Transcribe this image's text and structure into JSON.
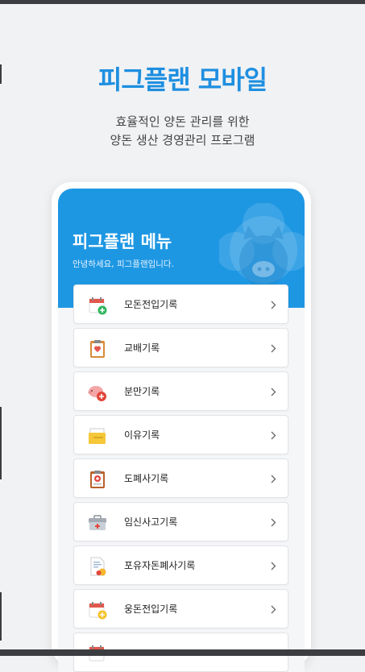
{
  "page": {
    "title": "피그플랜 모바일",
    "subtitle_line1": "효율적인 양돈 관리를 위한",
    "subtitle_line2": "양돈 생산 경영관리 프로그램"
  },
  "colors": {
    "accent": "#1e8fe0",
    "header_bg": "#1e97e3",
    "page_bg": "#f1f2f4"
  },
  "app": {
    "menu_title": "피그플랜 메뉴",
    "greeting": "안녕하세요, 피그플랜입니다.",
    "header_icon": "pig-icon"
  },
  "menu": {
    "items": [
      {
        "label": "모돈전입기록",
        "icon": "calendar-plus-icon"
      },
      {
        "label": "교배기록",
        "icon": "clipboard-heart-icon"
      },
      {
        "label": "분만기록",
        "icon": "piglet-heart-icon"
      },
      {
        "label": "이유기록",
        "icon": "folder-icon"
      },
      {
        "label": "도폐사기록",
        "icon": "clipboard-cross-icon"
      },
      {
        "label": "임신사고기록",
        "icon": "first-aid-kit-icon"
      },
      {
        "label": "포유자돈폐사기록",
        "icon": "document-warning-icon"
      },
      {
        "label": "웅돈전입기록",
        "icon": "calendar-plus-yellow-icon"
      },
      {
        "label": "",
        "icon": "calendar-icon"
      }
    ]
  }
}
